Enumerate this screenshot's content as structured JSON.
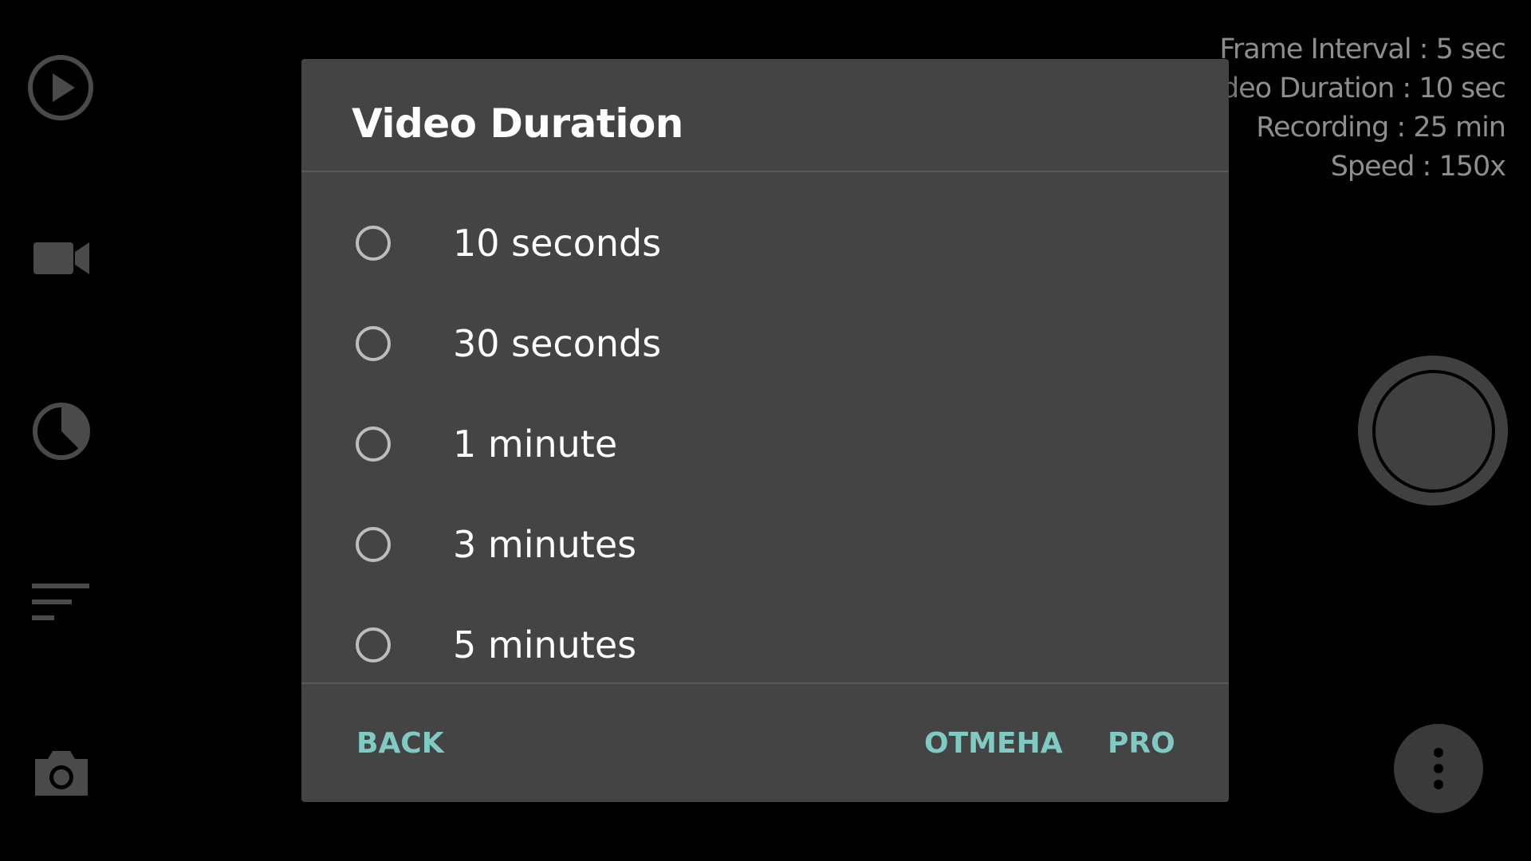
{
  "sidebar": {
    "icons": [
      "play-circle-icon",
      "videocam-icon",
      "timer-pie-icon",
      "sort-list-icon",
      "camera-icon"
    ]
  },
  "stats": {
    "frame_interval": "Frame Interval : 5 sec",
    "video_duration": "deo Duration : 10 sec",
    "recording": "Recording : 25 min",
    "speed": "Speed : 150x"
  },
  "dialog": {
    "title": "Video Duration",
    "options": [
      {
        "label": "10 seconds",
        "selected": false
      },
      {
        "label": "30 seconds",
        "selected": false
      },
      {
        "label": "1 minute",
        "selected": false
      },
      {
        "label": "3 minutes",
        "selected": false
      },
      {
        "label": "5 minutes",
        "selected": false
      }
    ],
    "buttons": {
      "back": "BACK",
      "cancel": "ОТМЕНА",
      "pro": "PRO"
    }
  },
  "colors": {
    "accent": "#7fcbc4",
    "dialog_bg": "#444444",
    "background": "#000000"
  }
}
